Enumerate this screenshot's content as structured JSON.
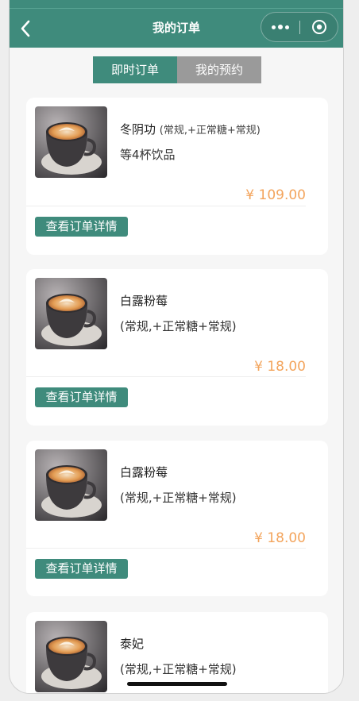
{
  "header": {
    "title": "我的订单",
    "back_icon": "chevron-left-icon",
    "capsule_more_icon": "more-dots-icon",
    "capsule_close_icon": "target-circle-icon"
  },
  "tabs": [
    {
      "label": "即时订单",
      "active": true
    },
    {
      "label": "我的预约",
      "active": false
    }
  ],
  "orders": [
    {
      "name": "冬阴功",
      "spec_inline": "(常规,+正常糖+常规)",
      "line2": "等4杯饮品",
      "price": "¥ 109.00",
      "button": "查看订单详情"
    },
    {
      "name": "白露粉莓",
      "line2": "(常规,+正常糖+常规)",
      "price": "¥ 18.00",
      "button": "查看订单详情"
    },
    {
      "name": "白露粉莓",
      "line2": "(常规,+正常糖+常规)",
      "price": "¥ 18.00",
      "button": "查看订单详情"
    },
    {
      "name": "泰妃",
      "line2": "(常规,+正常糖+常规)"
    }
  ],
  "colors": {
    "brand": "#3f8b7c",
    "price": "#f3a45c",
    "tab_inactive": "#9a9a9a"
  }
}
